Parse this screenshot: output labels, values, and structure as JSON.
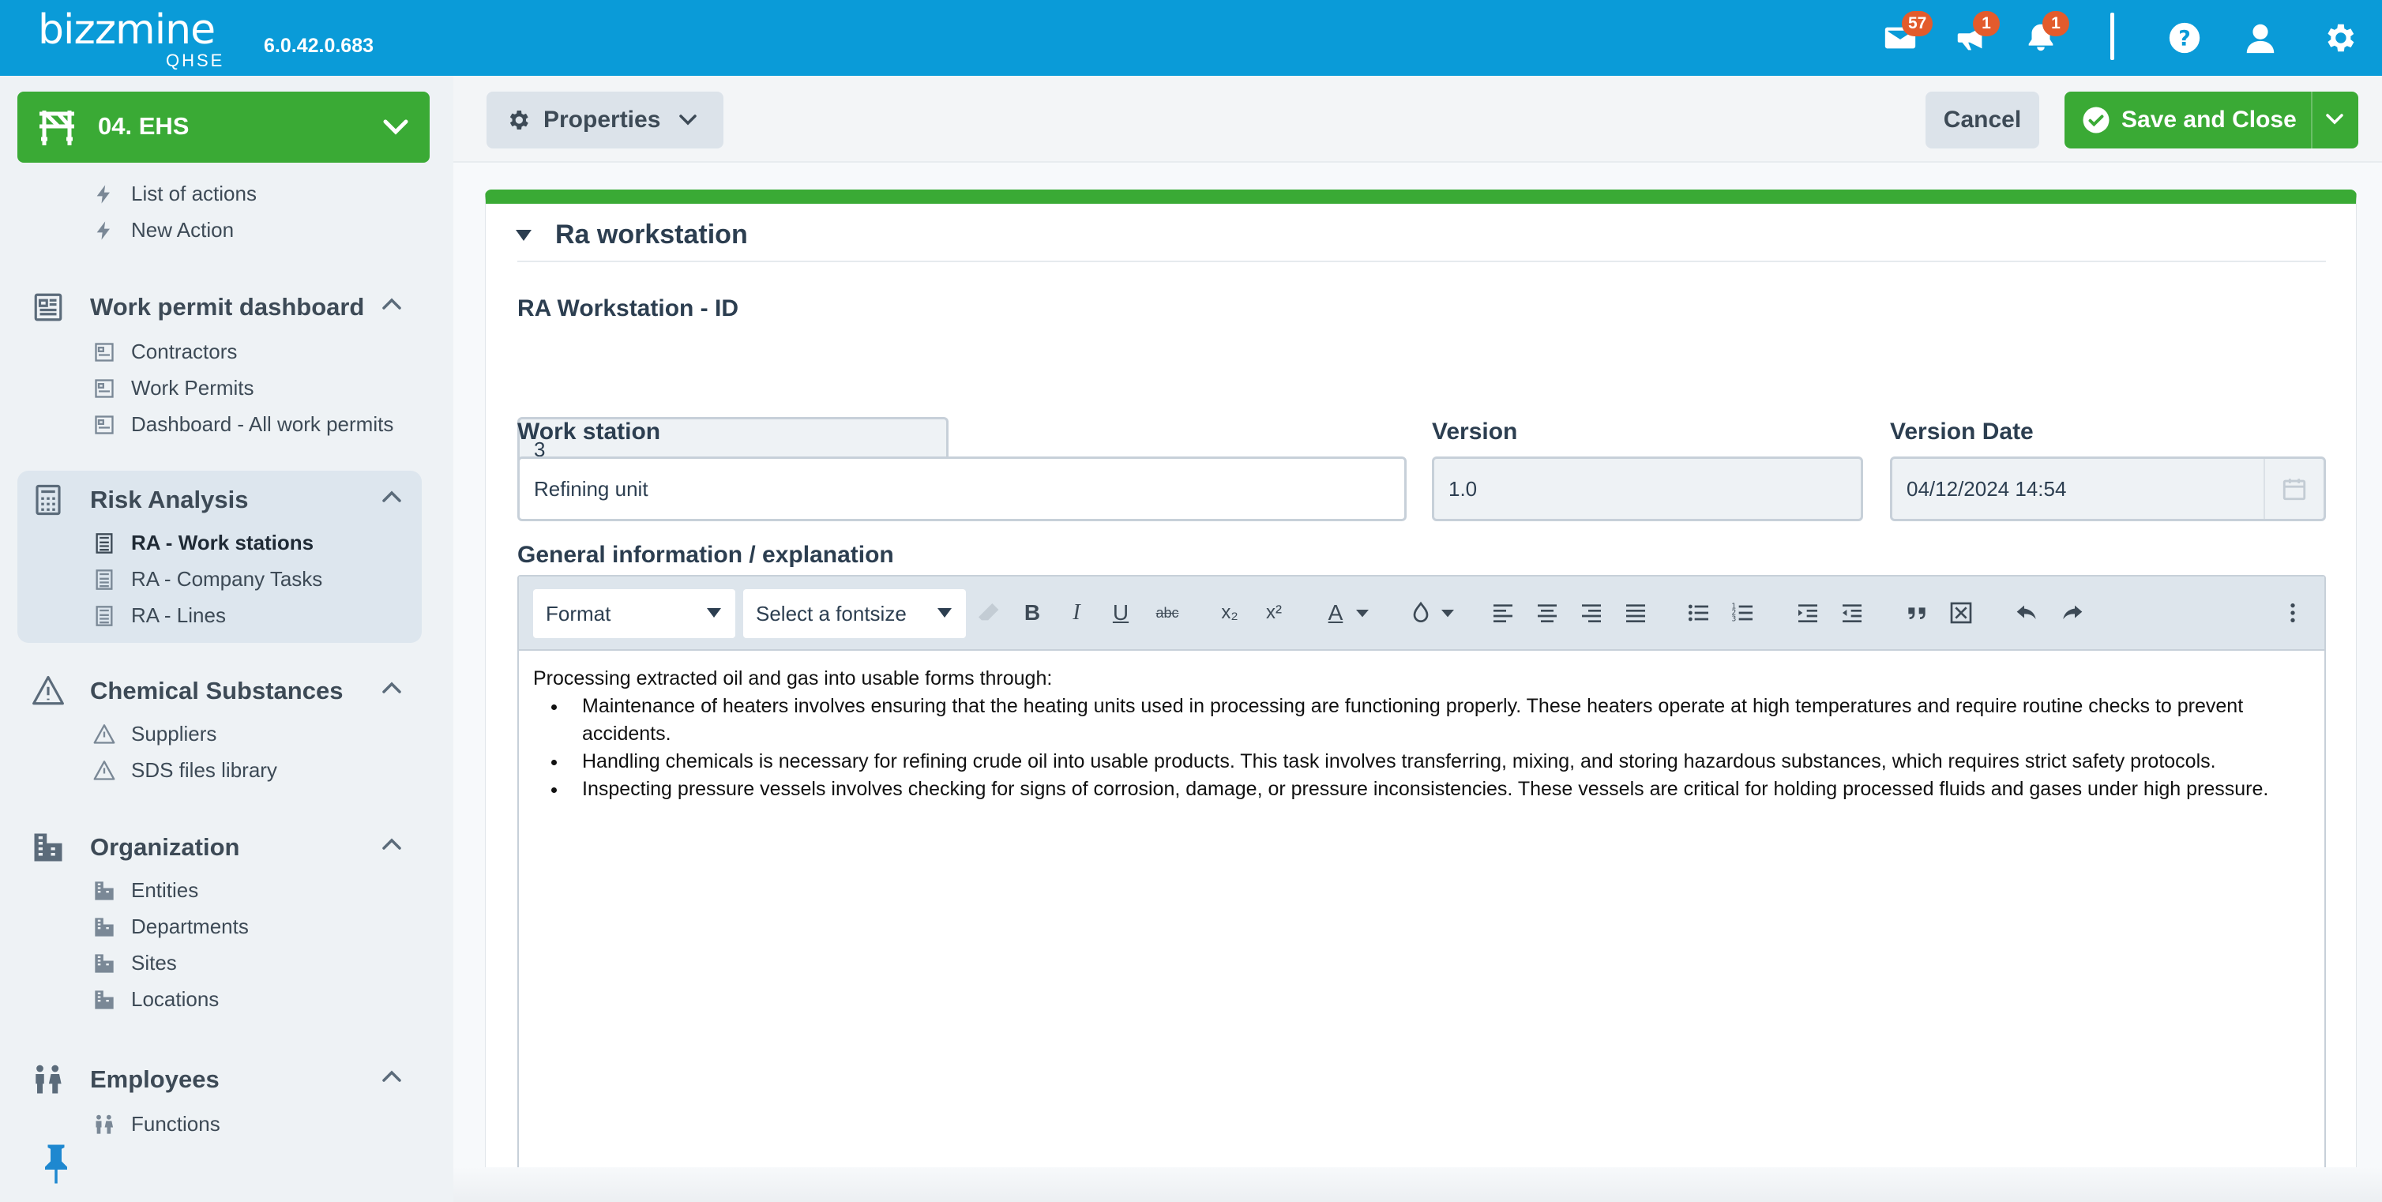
{
  "topbar": {
    "logo_word": "bizzmine",
    "logo_sub": "QHSE",
    "version": "6.0.42.0.683",
    "icons": [
      {
        "name": "mail-icon",
        "badge": "57"
      },
      {
        "name": "megaphone-icon",
        "badge": "1"
      },
      {
        "name": "bell-icon",
        "badge": "1"
      },
      {
        "name": "help-icon"
      },
      {
        "name": "user-icon"
      },
      {
        "name": "gear-icon"
      }
    ]
  },
  "sidebar": {
    "module": "04. EHS",
    "actions": [
      "List of actions",
      "New Action"
    ],
    "groups": [
      {
        "title": "Work permit dashboard",
        "items": [
          "Contractors",
          "Work Permits",
          "Dashboard - All work permits"
        ]
      },
      {
        "title": "Risk Analysis",
        "items": [
          "RA - Work stations",
          "RA - Company Tasks",
          "RA - Lines"
        ],
        "active_item": "RA - Work stations"
      },
      {
        "title": "Chemical Substances",
        "items": [
          "Suppliers",
          "SDS files library"
        ]
      },
      {
        "title": "Organization",
        "items": [
          "Entities",
          "Departments",
          "Sites",
          "Locations"
        ]
      },
      {
        "title": "Employees",
        "items": [
          "Functions"
        ]
      }
    ]
  },
  "toolbar": {
    "properties_label": "Properties",
    "cancel_label": "Cancel",
    "save_label": "Save and Close"
  },
  "form": {
    "section_title": "Ra workstation",
    "id_label": "RA Workstation - ID",
    "id_value": "3",
    "workstation_label": "Work station",
    "workstation_value": "Refining unit",
    "version_label": "Version",
    "version_value": "1.0",
    "version_date_label": "Version Date",
    "version_date_value": "04/12/2024 14:54",
    "general_label": "General information / explanation"
  },
  "editor": {
    "format_select": "Format",
    "fontsize_select": "Select a fontsize",
    "intro": "Processing extracted oil and gas into usable forms through:",
    "bullets": [
      "Maintenance of heaters involves ensuring that the heating units used in processing are functioning properly. These heaters operate at high temperatures and require routine checks to prevent accidents.",
      "Handling chemicals is necessary for refining crude oil into usable products. This task involves transferring, mixing, and storing hazardous substances, which requires strict safety protocols.",
      "Inspecting pressure vessels involves checking for signs of corrosion, damage, or pressure inconsistencies. These vessels are critical for holding processed fluids and gases under high pressure."
    ]
  },
  "colors": {
    "topbar": "#0a9bd8",
    "accent_green": "#3aaa35",
    "badge": "#e35b2c",
    "sidebar_active_bg": "#dde6ee"
  }
}
